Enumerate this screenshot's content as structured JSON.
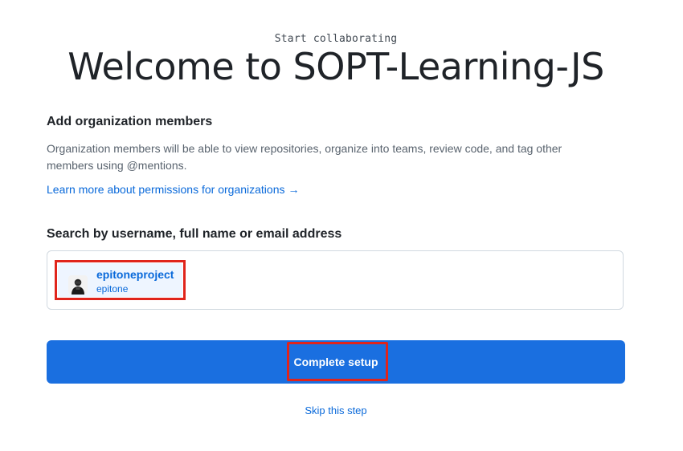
{
  "header": {
    "kicker": "Start collaborating",
    "title": "Welcome to SOPT-Learning-JS"
  },
  "members_section": {
    "heading": "Add organization members",
    "description": "Organization members will be able to view repositories, organize into teams, review code, and tag other members using @mentions.",
    "learn_more_link": "Learn more about permissions for organizations",
    "learn_more_arrow": "→"
  },
  "search": {
    "label": "Search by username, full name or email address",
    "selected_members": [
      {
        "login": "epitoneproject",
        "name": "epitone"
      }
    ]
  },
  "actions": {
    "complete_label": "Complete setup",
    "skip_label": "Skip this step"
  },
  "colors": {
    "primary_button": "#1a6fe0",
    "link": "#0969da",
    "highlight_border": "#e0241b",
    "chip_background": "#eef5ff"
  }
}
